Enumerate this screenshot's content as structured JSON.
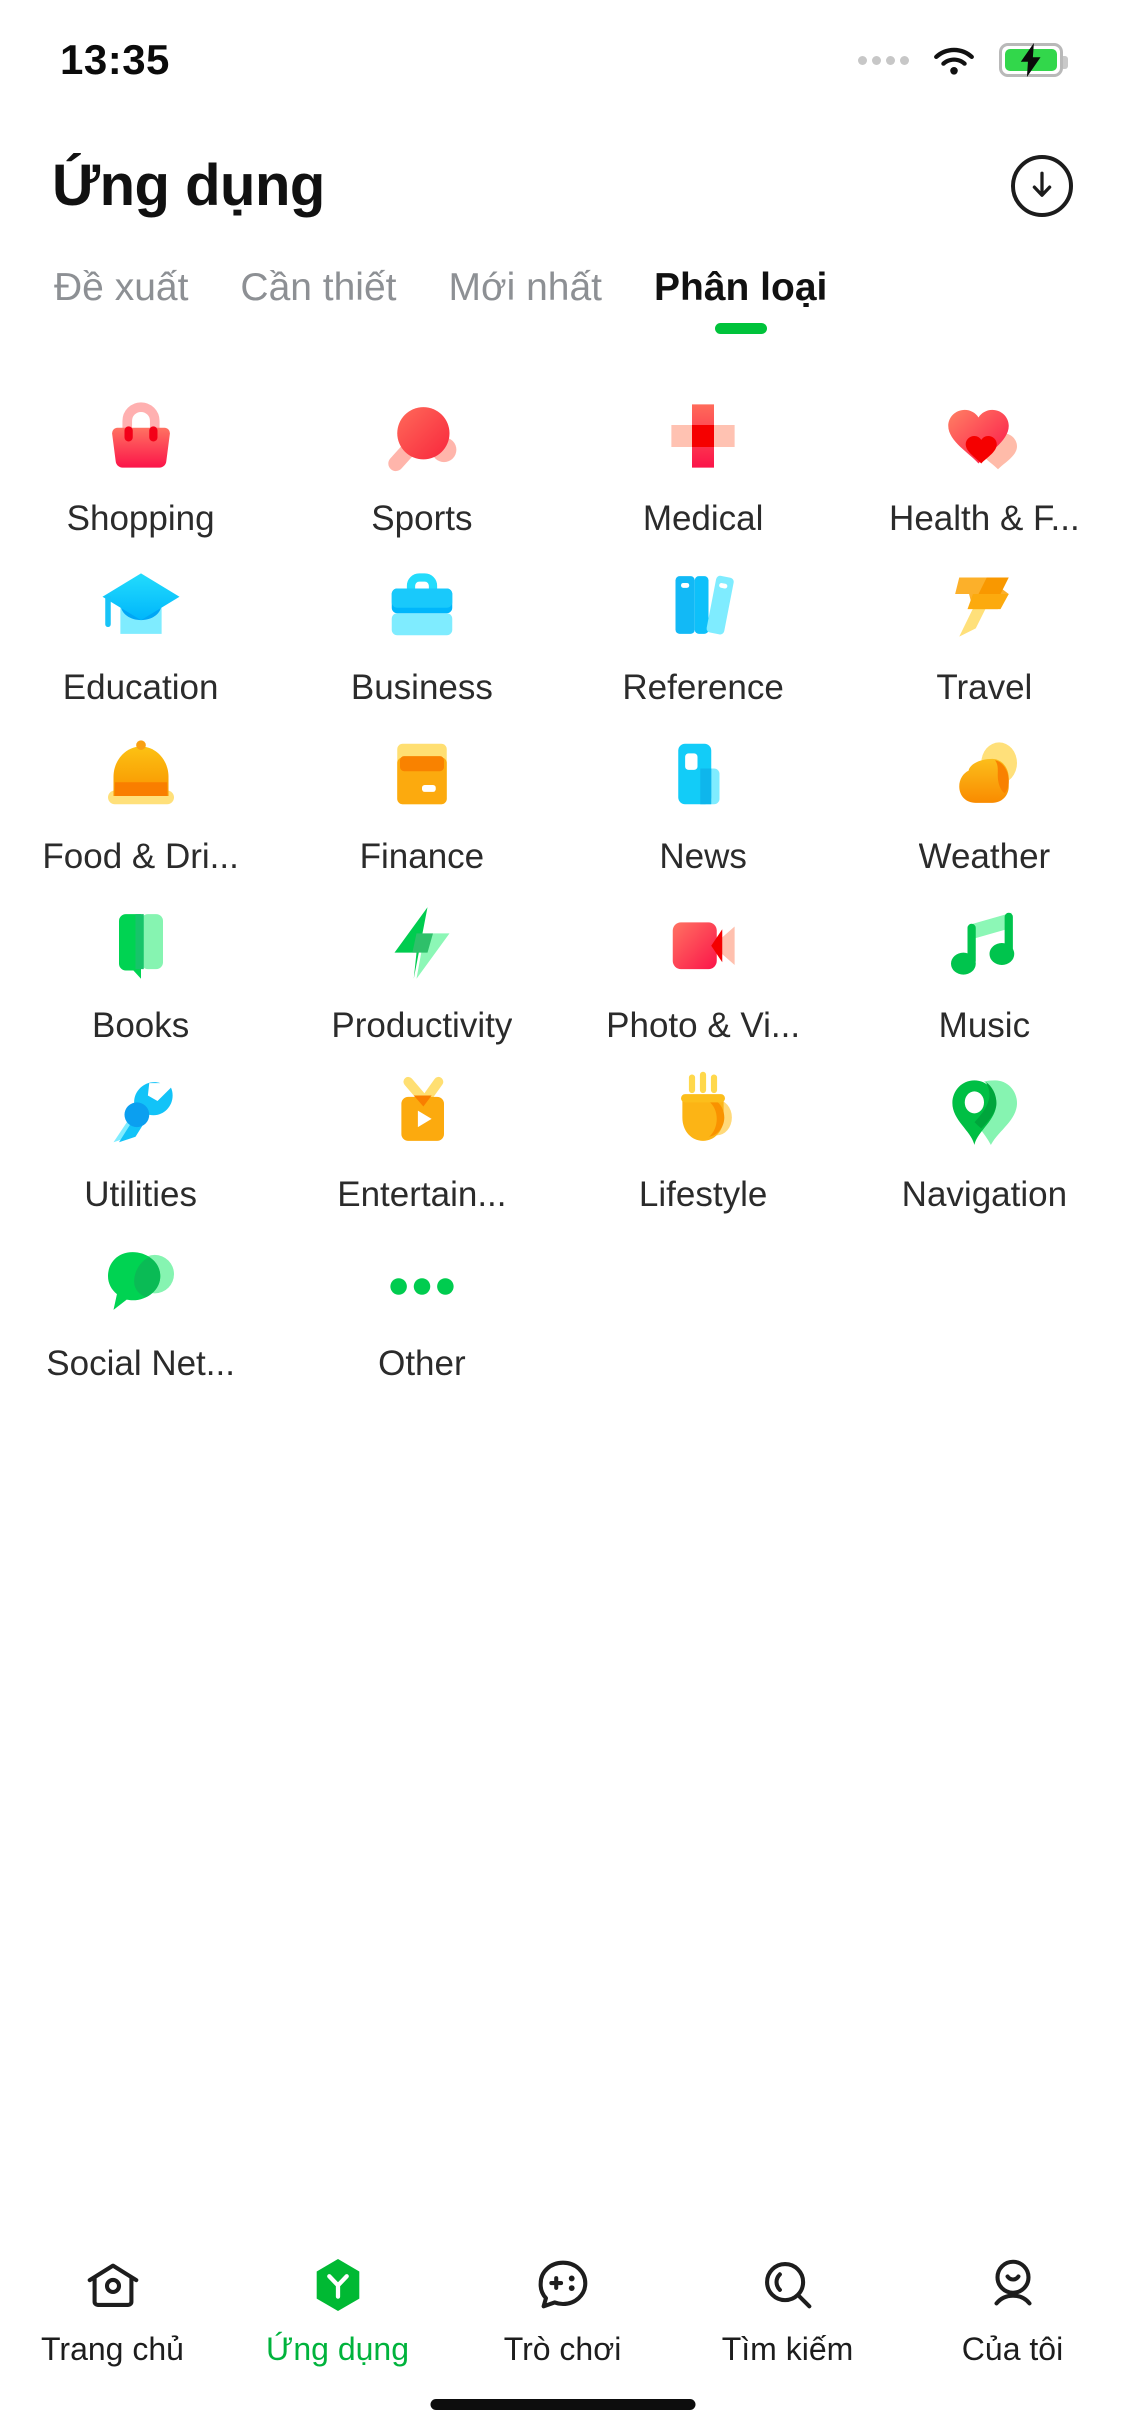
{
  "status_bar": {
    "time": "13:35",
    "signal_icon": "signal-dots-icon",
    "wifi_icon": "wifi-icon",
    "battery_icon": "battery-charging-icon",
    "battery_color": "#32d74b"
  },
  "header": {
    "title": "Ứng dụng",
    "download_icon": "download-circle-icon"
  },
  "tabs": {
    "accent_color": "#00c33b",
    "items": [
      {
        "label": "Đề xuất",
        "active": false
      },
      {
        "label": "Cần thiết",
        "active": false
      },
      {
        "label": "Mới nhất",
        "active": false
      },
      {
        "label": "Phân loại",
        "active": true
      }
    ]
  },
  "categories": [
    {
      "label": "Shopping",
      "icon": "shopping-bag-icon",
      "color": "#fa3c4c"
    },
    {
      "label": "Sports",
      "icon": "ping-pong-icon",
      "color": "#fb4a4a"
    },
    {
      "label": "Medical",
      "icon": "medical-cross-icon",
      "color": "#f91616"
    },
    {
      "label": "Health & F...",
      "icon": "heart-icon",
      "color": "#fb3c5a"
    },
    {
      "label": "Education",
      "icon": "graduation-cap-icon",
      "color": "#00c8f8"
    },
    {
      "label": "Business",
      "icon": "briefcase-icon",
      "color": "#17c3f7"
    },
    {
      "label": "Reference",
      "icon": "books-icon",
      "color": "#12b9f6"
    },
    {
      "label": "Travel",
      "icon": "airplane-icon",
      "color": "#f9a012"
    },
    {
      "label": "Food & Dri...",
      "icon": "food-cloche-icon",
      "color": "#fca60d"
    },
    {
      "label": "Finance",
      "icon": "credit-card-icon",
      "color": "#fca60d"
    },
    {
      "label": "News",
      "icon": "newspaper-icon",
      "color": "#12ccf8"
    },
    {
      "label": "Weather",
      "icon": "cloud-sun-icon",
      "color": "#fca60d"
    },
    {
      "label": "Books",
      "icon": "open-book-icon",
      "color": "#00d352"
    },
    {
      "label": "Productivity",
      "icon": "lightning-bolt-icon",
      "color": "#00cc4f"
    },
    {
      "label": "Photo & Vi...",
      "icon": "video-camera-icon",
      "color": "#fa3c4c"
    },
    {
      "label": "Music",
      "icon": "music-note-icon",
      "color": "#00c44d"
    },
    {
      "label": "Utilities",
      "icon": "wrench-icon",
      "color": "#12c3f8"
    },
    {
      "label": "Entertain...",
      "icon": "tv-play-icon",
      "color": "#fca60d"
    },
    {
      "label": "Lifestyle",
      "icon": "coffee-cup-icon",
      "color": "#fcb415"
    },
    {
      "label": "Navigation",
      "icon": "map-pin-icon",
      "color": "#00bf44"
    },
    {
      "label": "Social Net...",
      "icon": "chat-bubble-icon",
      "color": "#00d352"
    },
    {
      "label": "Other",
      "icon": "ellipsis-icon",
      "color": "#00cc4f"
    }
  ],
  "bottom_nav": {
    "active_color": "#00b33c",
    "items": [
      {
        "label": "Trang chủ",
        "icon": "home-icon",
        "active": false
      },
      {
        "label": "Ứng dụng",
        "icon": "apps-hex-icon",
        "active": true
      },
      {
        "label": "Trò chơi",
        "icon": "game-face-icon",
        "active": false
      },
      {
        "label": "Tìm kiếm",
        "icon": "search-icon",
        "active": false
      },
      {
        "label": "Của tôi",
        "icon": "profile-icon",
        "active": false
      }
    ]
  }
}
